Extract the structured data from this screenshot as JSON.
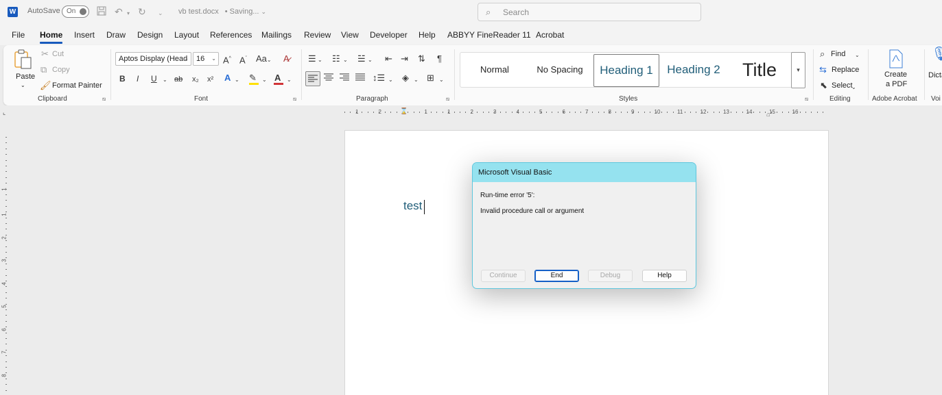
{
  "titlebar": {
    "app_logo": "W",
    "autosave_label": "AutoSave",
    "autosave_state": "On",
    "doc_name": "vb test.docx",
    "doc_status": "• Saving...",
    "search_placeholder": "Search",
    "icons": [
      "word-logo-icon",
      "save-icon",
      "undo-icon",
      "redo-icon",
      "customize-icon",
      "search-icon"
    ]
  },
  "tabs": [
    "File",
    "Home",
    "Insert",
    "Draw",
    "Design",
    "Layout",
    "References",
    "Mailings",
    "Review",
    "View",
    "Developer",
    "Help",
    "ABBYY FineReader 11",
    "Acrobat"
  ],
  "active_tab": "Home",
  "ribbon": {
    "clipboard": {
      "label": "Clipboard",
      "paste": "Paste",
      "cut": "Cut",
      "copy": "Copy",
      "format_painter": "Format Painter"
    },
    "font": {
      "label": "Font",
      "font_name": "Aptos Display (Head",
      "font_size": "16",
      "bold": "B",
      "italic": "I",
      "underline": "U",
      "strike": "ab",
      "subscript": "x₂",
      "superscript": "x²",
      "change_case": "Aa"
    },
    "paragraph": {
      "label": "Paragraph"
    },
    "styles": {
      "label": "Styles",
      "items": [
        "Normal",
        "No Spacing",
        "Heading 1",
        "Heading 2",
        "Title"
      ],
      "selected": "Heading 1"
    },
    "editing": {
      "label": "Editing",
      "find": "Find",
      "replace": "Replace",
      "select": "Select"
    },
    "acrobat": {
      "label": "Adobe Acrobat",
      "create_pdf_line1": "Create",
      "create_pdf_line2": "a PDF"
    },
    "voice": {
      "label": "Voi",
      "dictate": "Dicta"
    }
  },
  "ruler": {
    "ticks": [
      "1",
      "2",
      "1",
      "1",
      "2",
      "3",
      "4",
      "5",
      "6",
      "7",
      "8",
      "9",
      "10",
      "11",
      "12",
      "13",
      "14",
      "15",
      "16"
    ],
    "vticks": [
      "1",
      "1",
      "2",
      "3",
      "4",
      "5",
      "6",
      "7",
      "8"
    ]
  },
  "document": {
    "text": "test"
  },
  "dialog": {
    "title": "Microsoft Visual Basic",
    "error_line": "Run-time error '5':",
    "error_detail": "Invalid procedure call or argument",
    "buttons": {
      "continue": "Continue",
      "end": "End",
      "debug": "Debug",
      "help": "Help"
    }
  },
  "colors": {
    "accent": "#185abd",
    "dialog_title_bg": "#95e2ef",
    "dialog_border": "#5dc7de",
    "doc_text": "#215e79",
    "font_color_red": "#d13438",
    "highlight_yellow": "#ffe000"
  }
}
